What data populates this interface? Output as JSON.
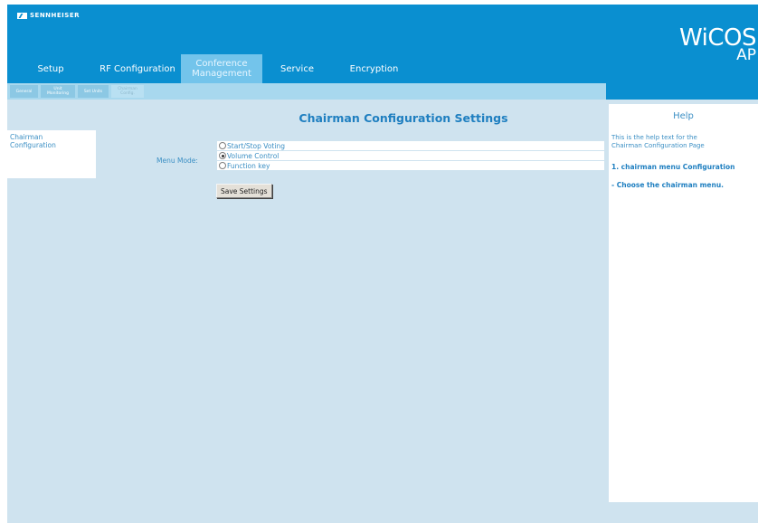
{
  "header": {
    "brand": "SENNHEISER",
    "product_line1": "WiCOS",
    "product_line2": "AP"
  },
  "tabs": [
    {
      "label": "Setup"
    },
    {
      "label": "RF Configuration"
    },
    {
      "label_line1": "Conference",
      "label_line2": "Management",
      "active": true
    },
    {
      "label": "Service"
    },
    {
      "label": "Encryption"
    }
  ],
  "subtabs": [
    {
      "label": "General"
    },
    {
      "label_line1": "Unit",
      "label_line2": "Monitoring"
    },
    {
      "label": "Set Units"
    },
    {
      "label_line1": "Chairman",
      "label_line2": "Config.",
      "active": true
    }
  ],
  "sidebar": {
    "item_line1": "Chairman",
    "item_line2": "Configuration"
  },
  "main": {
    "title": "Chairman Configuration Settings",
    "menu_mode_label": "Menu Mode:",
    "options": [
      {
        "label": "Start/Stop Voting",
        "checked": false
      },
      {
        "label": "Volume Control",
        "checked": true
      },
      {
        "label": "Function key",
        "checked": false
      }
    ],
    "save_label": "Save Settings"
  },
  "help": {
    "title": "Help",
    "intro_line1": "This is the help text for the",
    "intro_line2": "Chairman Configuration Page",
    "step1": "1. chairman menu Configuration",
    "step2": "- Choose the chairman menu."
  },
  "colors": {
    "header_blue": "#0a8fd0",
    "page_bg": "#cfe3ef",
    "text_blue": "#3b8fc4"
  }
}
